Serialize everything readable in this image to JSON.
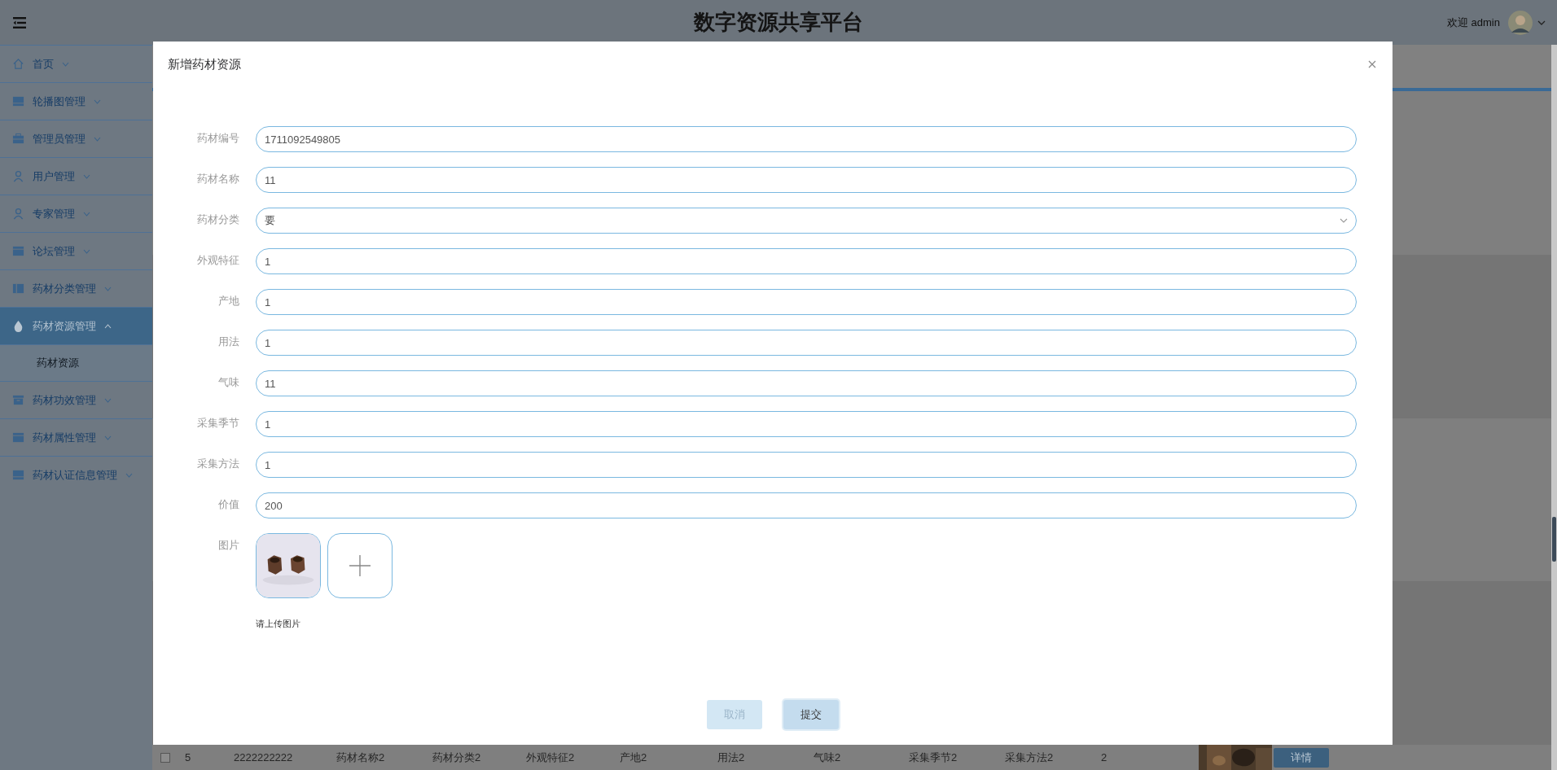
{
  "header": {
    "title": "数字资源共享平台",
    "greeting": "欢迎 admin"
  },
  "sidebar": {
    "items": [
      {
        "label": "首页",
        "selected": false,
        "expanded": false
      },
      {
        "label": "轮播图管理",
        "selected": false,
        "expanded": false
      },
      {
        "label": "管理员管理",
        "selected": false,
        "expanded": false
      },
      {
        "label": "用户管理",
        "selected": false,
        "expanded": false
      },
      {
        "label": "专家管理",
        "selected": false,
        "expanded": false
      },
      {
        "label": "论坛管理",
        "selected": false,
        "expanded": false
      },
      {
        "label": "药材分类管理",
        "selected": false,
        "expanded": false
      },
      {
        "label": "药材资源管理",
        "selected": true,
        "expanded": true,
        "children": [
          {
            "label": "药材资源",
            "selected": true
          }
        ]
      },
      {
        "label": "药材功效管理",
        "selected": false,
        "expanded": false
      },
      {
        "label": "药材属性管理",
        "selected": false,
        "expanded": false
      },
      {
        "label": "药材认证信息管理",
        "selected": false,
        "expanded": false
      }
    ]
  },
  "background_row": {
    "checked": false,
    "cells": [
      "5",
      "2222222222",
      "药材名称2",
      "药材分类2",
      "外观特征2",
      "产地2",
      "用法2",
      "气味2",
      "采集季节2",
      "采集方法2",
      "2"
    ],
    "button": "详情"
  },
  "dialog": {
    "title": "新增药材资源",
    "fields": [
      {
        "label": "药材编号",
        "value": "1711092549805",
        "kind": "input"
      },
      {
        "label": "药材名称",
        "value": "11",
        "kind": "input"
      },
      {
        "label": "药材分类",
        "value": "要",
        "kind": "select"
      },
      {
        "label": "外观特征",
        "value": "1",
        "kind": "input"
      },
      {
        "label": "产地",
        "value": "1",
        "kind": "input"
      },
      {
        "label": "用法",
        "value": "1",
        "kind": "input"
      },
      {
        "label": "气味",
        "value": "11",
        "kind": "input"
      },
      {
        "label": "采集季节",
        "value": "1",
        "kind": "input"
      },
      {
        "label": "采集方法",
        "value": "1",
        "kind": "input"
      },
      {
        "label": "价值",
        "value": "200",
        "kind": "input"
      }
    ],
    "upload": {
      "label": "图片",
      "hint": "请上传图片"
    },
    "buttons": [
      {
        "label": "取消",
        "kind": "cancel"
      },
      {
        "label": "提交",
        "kind": "submit"
      }
    ]
  }
}
